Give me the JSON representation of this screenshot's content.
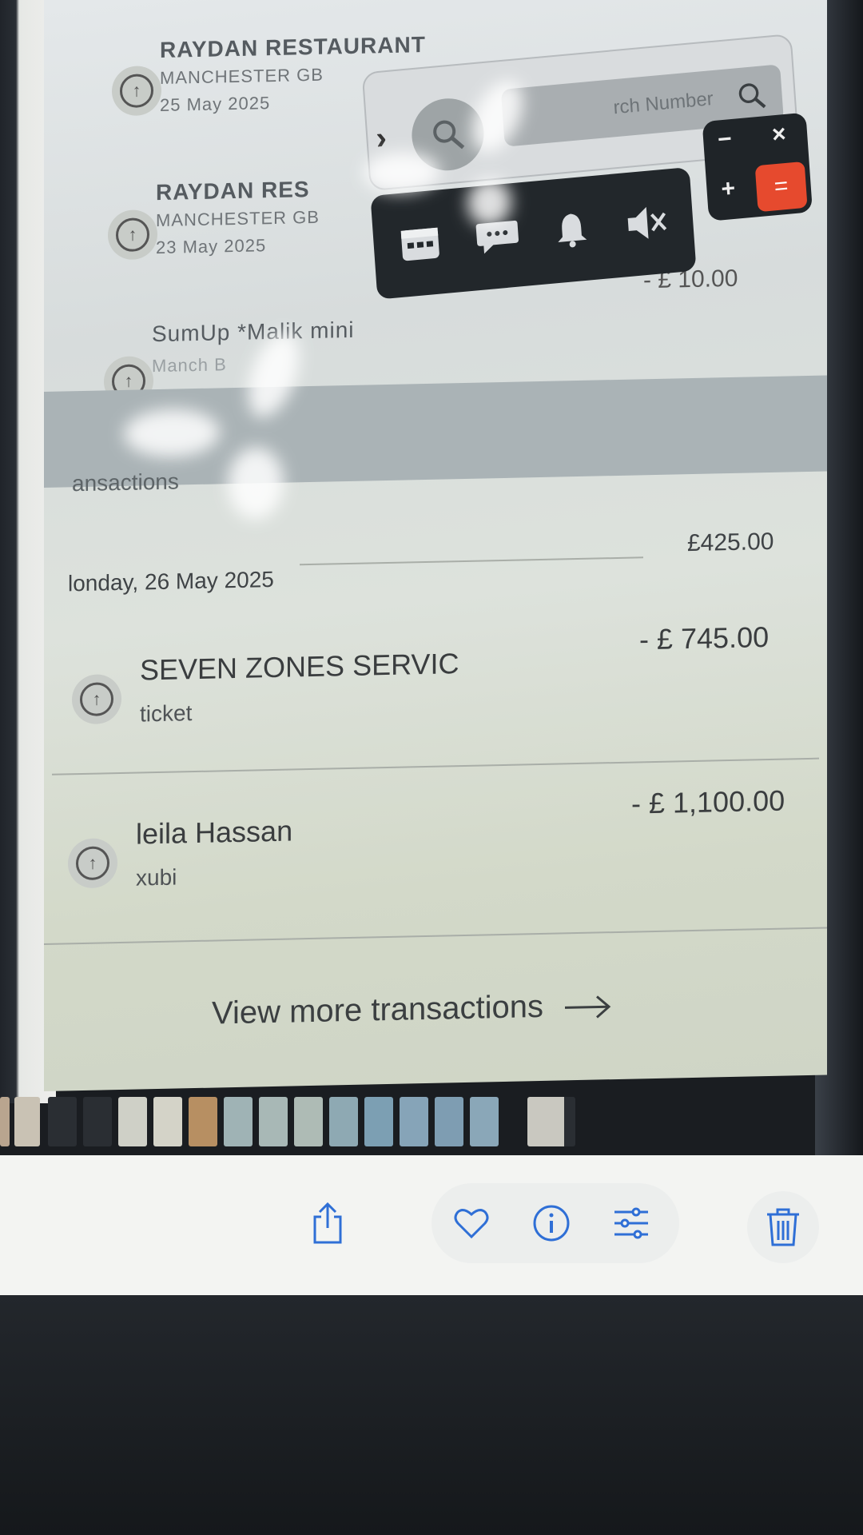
{
  "transactions_top": [
    {
      "merchant": "RAYDAN RESTAURANT",
      "location": "MANCHESTER GB",
      "date": "25 May 2025"
    },
    {
      "merchant": "RAYDAN RES",
      "location": "MANCHESTER GB",
      "date": "23 May 2025"
    },
    {
      "merchant": "SumUp *Malik mini",
      "location": "Manch   B",
      "date": "",
      "amount": "- £ 10.00"
    }
  ],
  "section": {
    "label": "ansactions"
  },
  "day": {
    "label": "londay, 26 May 2025",
    "total": "£425.00"
  },
  "transactions": [
    {
      "name": "SEVEN ZONES SERVIC",
      "reference": "ticket",
      "amount": "- £ 745.00"
    },
    {
      "name": "leila Hassan",
      "reference": "xubi",
      "amount": "- £ 1,100.00"
    }
  ],
  "view_more": {
    "label": "View more transactions",
    "icon": "arrow-right-icon"
  },
  "search_overlay": {
    "placeholder": "rch Number",
    "icons": [
      "chevron-right-icon",
      "search-icon"
    ]
  },
  "float_toolbar": {
    "icons": [
      "calendar-icon",
      "chat-bubble-icon",
      "bell-icon",
      "mute-icon"
    ]
  },
  "calculator": {
    "keys": [
      "−",
      "×",
      "+",
      "="
    ],
    "accent": "#e64a2e"
  },
  "photos_bar": {
    "icons": [
      "share-icon",
      "heart-icon",
      "info-icon",
      "adjust-icon",
      "trash-icon"
    ],
    "accent": "#2f6fd6"
  }
}
